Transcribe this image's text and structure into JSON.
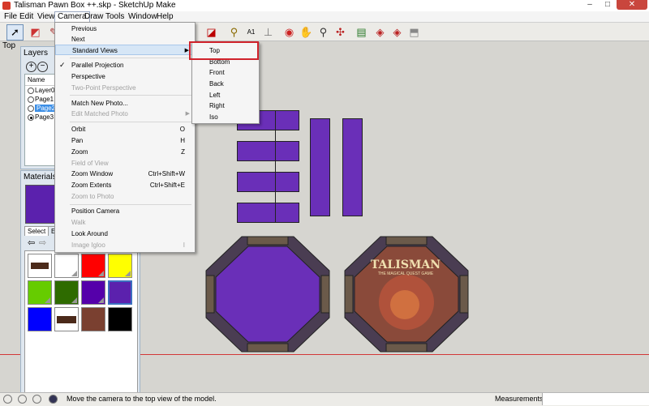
{
  "window": {
    "title": "Talisman Pawn Box ++.skp - SketchUp Make",
    "controls": [
      "–",
      "□",
      "✕"
    ]
  },
  "menubar": [
    "File",
    "Edit",
    "View",
    "Camera",
    "Draw",
    "Tools",
    "Window",
    "Help"
  ],
  "view_label": "Top",
  "layers_panel": {
    "title": "Layers",
    "column_header": "Name",
    "layers": [
      {
        "name": "Layer0",
        "active": false
      },
      {
        "name": "Page1",
        "active": false
      },
      {
        "name": "Page2",
        "active": false,
        "highlighted": true
      },
      {
        "name": "Page3",
        "active": true
      }
    ]
  },
  "materials_panel": {
    "title": "Materials",
    "tabs": [
      "Select",
      "Ed"
    ],
    "current_color": "#5b21ad",
    "swatches": [
      "#ffffff",
      "#ffffff",
      "#ff0000",
      "#ffff00",
      "#66cc00",
      "#2e6b00",
      "#5500aa",
      "#5b21ad",
      "#0000ff",
      "#4b2a1a",
      "#7a4030",
      "#000000"
    ]
  },
  "camera_menu": {
    "items": [
      {
        "label": "Previous"
      },
      {
        "label": "Next"
      },
      {
        "label": "Standard Views",
        "submenu": true,
        "highlighted": true
      },
      {
        "separator": true
      },
      {
        "label": "Parallel Projection",
        "checked": true
      },
      {
        "label": "Perspective"
      },
      {
        "label": "Two-Point Perspective",
        "disabled": true
      },
      {
        "separator": true
      },
      {
        "label": "Match New Photo..."
      },
      {
        "label": "Edit Matched Photo",
        "disabled": true,
        "submenu": true
      },
      {
        "separator": true
      },
      {
        "label": "Orbit",
        "shortcut": "O"
      },
      {
        "label": "Pan",
        "shortcut": "H"
      },
      {
        "label": "Zoom",
        "shortcut": "Z"
      },
      {
        "label": "Field of View",
        "disabled": true
      },
      {
        "label": "Zoom Window",
        "shortcut": "Ctrl+Shift+W"
      },
      {
        "label": "Zoom Extents",
        "shortcut": "Ctrl+Shift+E"
      },
      {
        "label": "Zoom to Photo",
        "disabled": true
      },
      {
        "separator": true
      },
      {
        "label": "Position Camera"
      },
      {
        "label": "Walk",
        "disabled": true
      },
      {
        "label": "Look Around"
      },
      {
        "label": "Image Igloo",
        "disabled": true,
        "shortcut": "I"
      }
    ]
  },
  "standard_views": [
    "Top",
    "Bottom",
    "Front",
    "Back",
    "Left",
    "Right",
    "Iso"
  ],
  "artwork": {
    "title": "TALISMAN",
    "subtitle": "THE MAGICAL QUEST GAME"
  },
  "status": {
    "message": "Move the camera to the top view of the model.",
    "measurements_label": "Measurements"
  },
  "colors": {
    "accent_purple": "#6a2fb8",
    "highlight_red": "#d0222b",
    "selection_blue": "#3b8ee6"
  }
}
